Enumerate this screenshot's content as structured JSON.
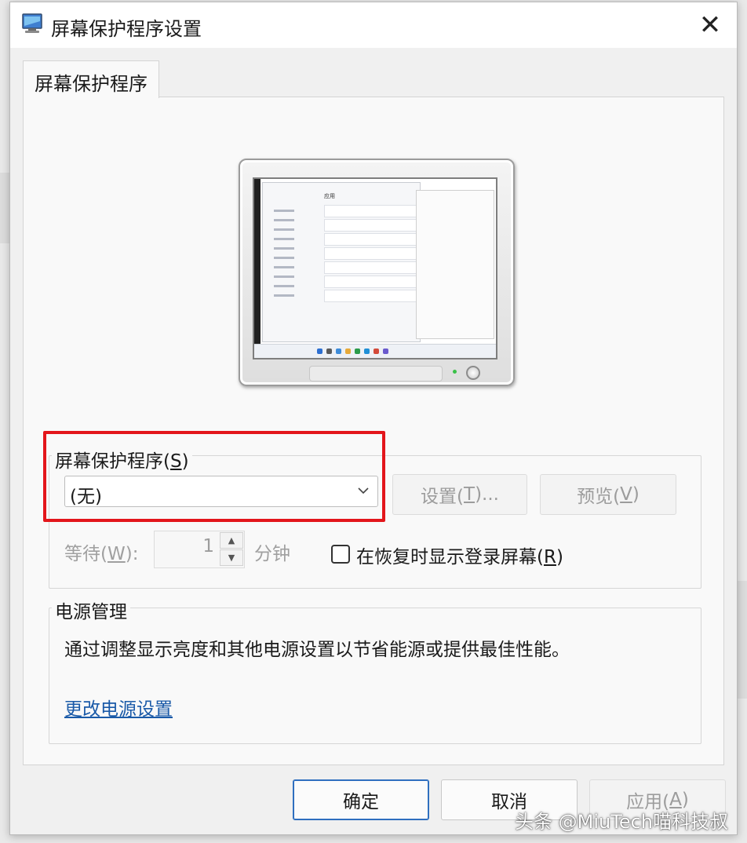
{
  "window": {
    "title": "屏幕保护程序设置",
    "icon": "monitor-settings-icon",
    "close_glyph": "✕"
  },
  "tabs": [
    {
      "label": "屏幕保护程序",
      "selected": true
    }
  ],
  "preview": {
    "screen_heading": "应用"
  },
  "screensaver_group": {
    "label_prefix": "屏幕保护程序(",
    "label_key": "S",
    "label_suffix": ")",
    "selected_value": "(无)",
    "settings_button": {
      "prefix": "设置(",
      "key": "T",
      "suffix": ")...",
      "enabled": false
    },
    "preview_button": {
      "prefix": "预览(",
      "key": "V",
      "suffix": ")",
      "enabled": false
    },
    "wait": {
      "label_prefix": "等待(",
      "label_key": "W",
      "label_suffix": "):",
      "value": "1",
      "unit": "分钟"
    },
    "resume_checkbox": {
      "label_prefix": "在恢复时显示登录屏幕(",
      "label_key": "R",
      "label_suffix": ")",
      "checked": false
    }
  },
  "power_group": {
    "label": "电源管理",
    "description": "通过调整显示亮度和其他电源设置以节省能源或提供最佳性能。",
    "link": "更改电源设置"
  },
  "footer": {
    "ok_label": "确定",
    "cancel_label": "取消",
    "apply_prefix": "应用(",
    "apply_key": "A",
    "apply_suffix": ")"
  },
  "watermark": "头条 @MiuTech喵科技叔",
  "colors": {
    "highlight_frame": "#e3161b",
    "link": "#1a5aa8",
    "default_button_border": "#2f6fbf"
  }
}
